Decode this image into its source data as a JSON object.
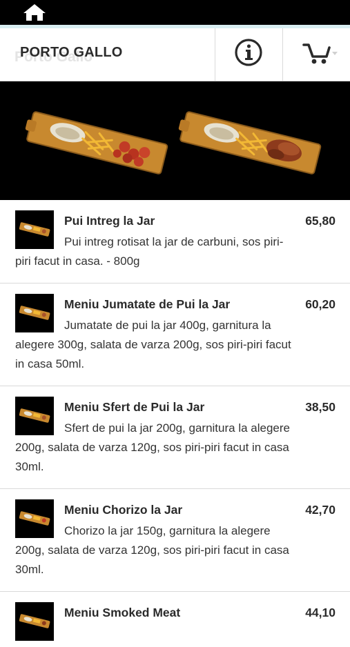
{
  "header": {
    "title": "PORTO GALLO",
    "title_ghost": "Porto Gallo"
  },
  "icons": {
    "home": "home-icon",
    "info": "info-icon",
    "cart": "cart-icon"
  },
  "colors": {
    "topbar": "#000000",
    "accent": "#d8eef2",
    "text": "#2a2a2a",
    "divider": "#d9d9d9"
  },
  "menu": {
    "items": [
      {
        "name": "Pui Intreg la Jar",
        "price": "65,80",
        "description": "Pui intreg rotisat la jar de carbuni, sos piri-piri facut in casa. - 800g"
      },
      {
        "name": "Meniu Jumatate de Pui la Jar",
        "price": "60,20",
        "description": "Jumatate de pui la jar 400g, garnitura la alegere 300g, salata de varza 200g, sos piri-piri facut in casa 50ml."
      },
      {
        "name": "Meniu Sfert de Pui la Jar",
        "price": "38,50",
        "description": "Sfert de pui la jar 200g, garnitura la alegere 200g, salata de varza 120g, sos piri-piri facut in casa 30ml."
      },
      {
        "name": "Meniu Chorizo la Jar",
        "price": "42,70",
        "description": "Chorizo la jar 150g, garnitura la alegere 200g, salata de varza 120g, sos piri-piri facut in casa 30ml."
      },
      {
        "name": "Meniu Smoked Meat",
        "price": "44,10",
        "description": ""
      }
    ]
  }
}
